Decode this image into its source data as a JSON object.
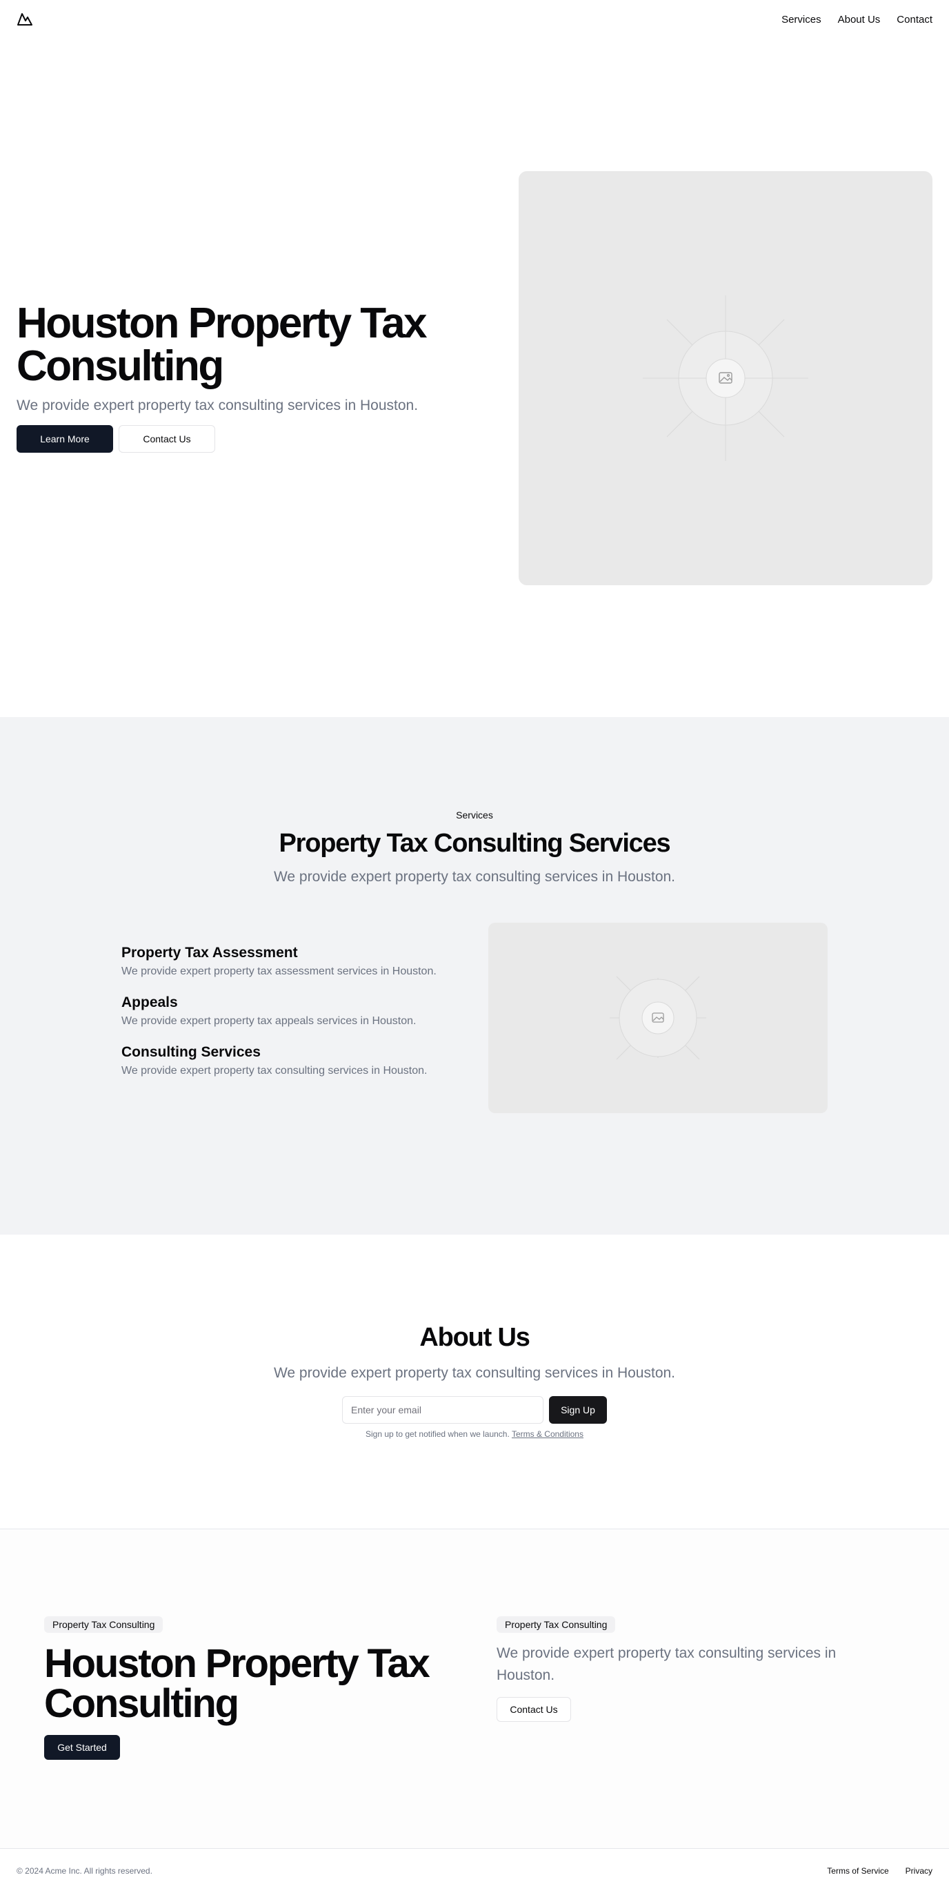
{
  "header": {
    "logo_icon": "mountain-icon",
    "nav": [
      "Services",
      "About Us",
      "Contact"
    ]
  },
  "hero": {
    "title": "Houston Property Tax Consulting",
    "subtitle": "We provide expert property tax consulting services in Houston.",
    "primary_button": "Learn More",
    "secondary_button": "Contact Us",
    "image_icon": "image-placeholder-icon"
  },
  "services": {
    "eyebrow": "Services",
    "title": "Property Tax Consulting Services",
    "subtitle": "We provide expert property tax consulting services in Houston.",
    "items": [
      {
        "title": "Property Tax Assessment",
        "description": "We provide expert property tax assessment services in Houston."
      },
      {
        "title": "Appeals",
        "description": "We provide expert property tax appeals services in Houston."
      },
      {
        "title": "Consulting Services",
        "description": "We provide expert property tax consulting services in Houston."
      }
    ],
    "image_icon": "image-placeholder-icon"
  },
  "about": {
    "title": "About Us",
    "subtitle": "We provide expert property tax consulting services in Houston.",
    "email_placeholder": "Enter your email",
    "signup_button": "Sign Up",
    "fine_print": "Sign up to get notified when we launch.",
    "terms_link": "Terms & Conditions"
  },
  "cta": {
    "left_badge": "Property Tax Consulting",
    "left_title": "Houston Property Tax Consulting",
    "left_button": "Get Started",
    "right_badge": "Property Tax Consulting",
    "right_subtitle": "We provide expert property tax consulting services in Houston.",
    "right_button": "Contact Us"
  },
  "footer": {
    "copyright": "© 2024 Acme Inc. All rights reserved.",
    "links": [
      "Terms of Service",
      "Privacy"
    ]
  },
  "colors": {
    "primary_dark": "#111827",
    "muted_text": "#6b7280",
    "section_bg": "#f2f3f5",
    "placeholder_bg": "#e9e9e9"
  }
}
